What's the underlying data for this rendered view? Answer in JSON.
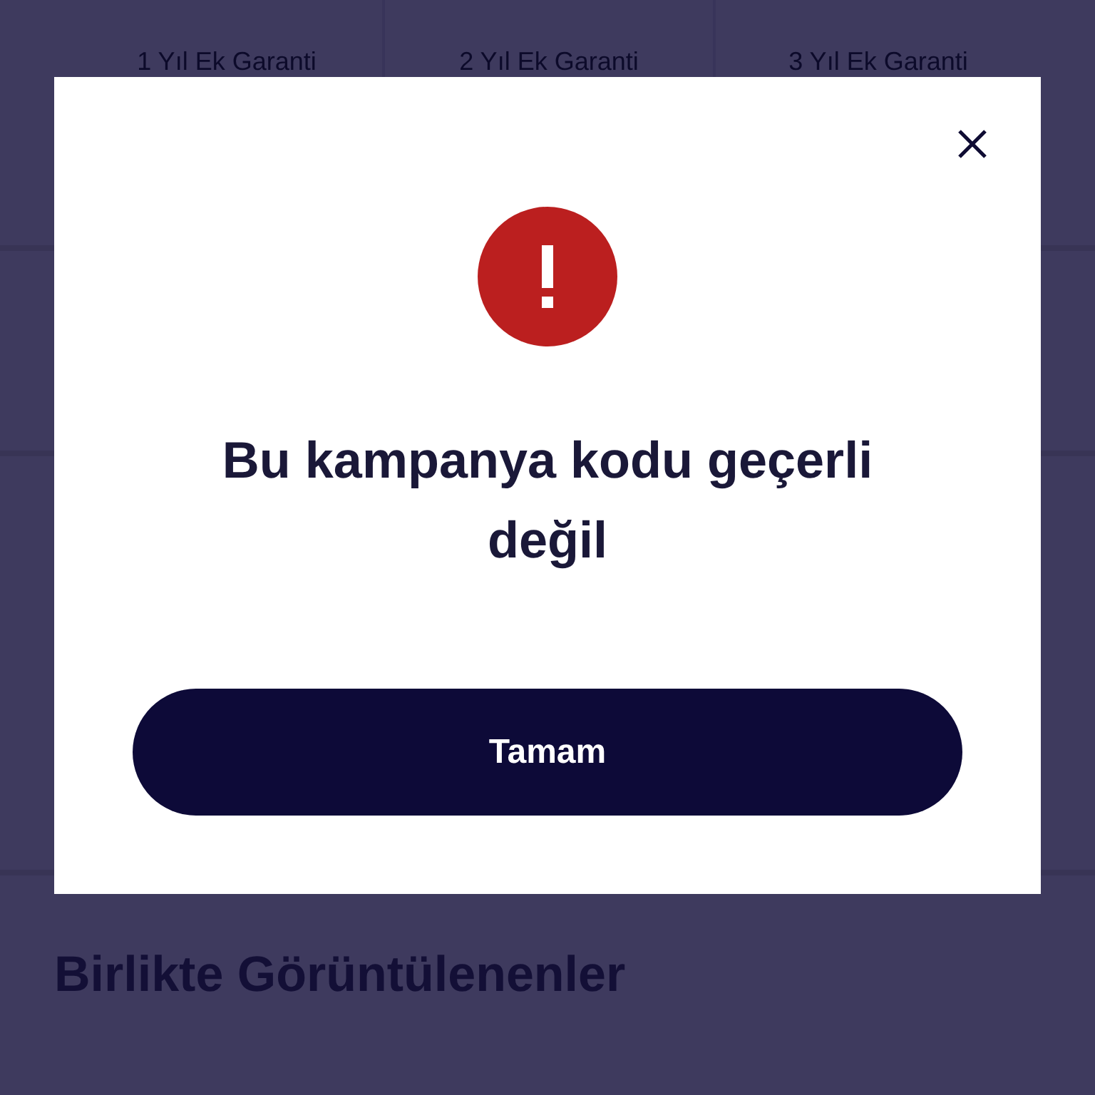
{
  "warranty_options": [
    {
      "label": "1 Yıl Ek Garanti"
    },
    {
      "label": "2 Yıl Ek Garanti"
    },
    {
      "label": "3 Yıl Ek Garanti"
    }
  ],
  "section_heading": "Birlikte Görüntülenenler",
  "dialog": {
    "message": "Bu kampanya kodu geçerli değil",
    "button": "Tamam"
  }
}
